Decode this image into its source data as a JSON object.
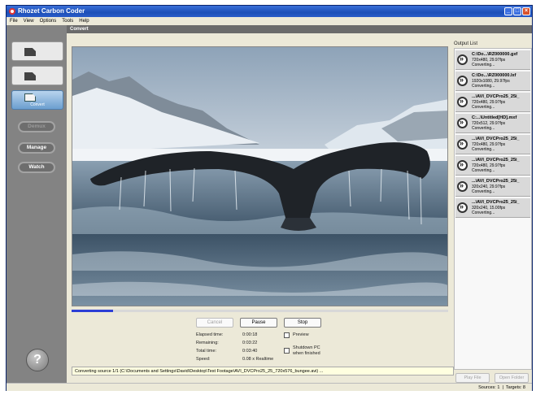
{
  "window": {
    "title": "Rhozet Carbon Coder"
  },
  "menu": [
    "File",
    "View",
    "Options",
    "Tools",
    "Help"
  ],
  "sidebar": {
    "tabs": [
      {
        "label": ""
      },
      {
        "label": ""
      },
      {
        "label": "Convert"
      }
    ],
    "buttons": [
      "Demux",
      "Manage",
      "Watch"
    ],
    "help": "?"
  },
  "header": {
    "title": "Convert"
  },
  "preview": {
    "progress_fraction": 0.11
  },
  "controls": {
    "cancel": "Cancel",
    "pause": "Pause",
    "stop": "Stop"
  },
  "stats": {
    "elapsed_label": "Elapsed time:",
    "elapsed": "0:00:18",
    "remaining_label": "Remaining:",
    "remaining": "0:03:22",
    "total_label": "Total time:",
    "total": "0:03:40",
    "speed_label": "Speed:",
    "speed": "0.08 x Realtime"
  },
  "options": {
    "preview": "Preview",
    "shutdown": "Shutdown PC when finished"
  },
  "status_line": "Converting source 1/1 (C:\\Documents and Settings\\David\\Desktop\\Test Footage\\AVI_DVCPro25_25_720x576_bungee.avi) ...",
  "output_list": {
    "title": "Output List",
    "items": [
      {
        "name": "C:\\Do...\\RZ000000.gxf",
        "spec": "720x480, 29.97fps",
        "status": "Converting..."
      },
      {
        "name": "C:\\Do...\\RZ000000.lxf",
        "spec": "1920x1080, 29.97fps",
        "status": "Converting..."
      },
      {
        "name": "...\\AVI_DVCPro25_25i_",
        "spec": "720x480, 29.97fps",
        "status": "Converting..."
      },
      {
        "name": "C:...\\Untitled[HD].mxf",
        "spec": "720x512, 29.97fps",
        "status": "Converting..."
      },
      {
        "name": "...\\AVI_DVCPro25_25i_",
        "spec": "720x480, 29.97fps",
        "status": "Converting..."
      },
      {
        "name": "...\\AVI_DVCPro25_25i_",
        "spec": "720x480, 29.97fps",
        "status": "Converting..."
      },
      {
        "name": "...\\AVI_DVCPro25_25i_",
        "spec": "320x240, 29.97fps",
        "status": "Converting..."
      },
      {
        "name": "...\\AVI_DVCPro25_25i_",
        "spec": "320x240, 15.00fps",
        "status": "Converting..."
      }
    ],
    "play_file": "Play File",
    "open_folder": "Open Folder"
  },
  "footer": {
    "sources": "Sources: 1",
    "targets": "Targets: 8"
  }
}
